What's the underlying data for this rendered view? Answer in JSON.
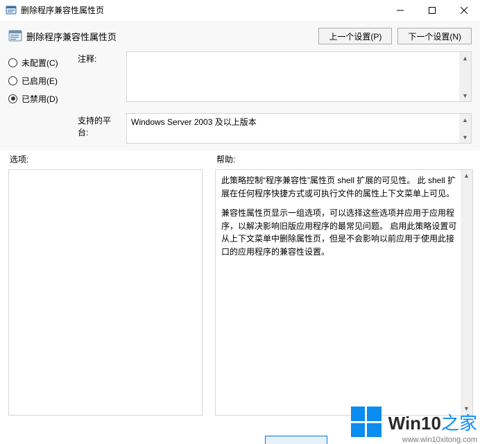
{
  "window": {
    "title": "删除程序兼容性属性页"
  },
  "header": {
    "subtitle": "删除程序兼容性属性页",
    "prev_button": "上一个设置(P)",
    "next_button": "下一个设置(N)"
  },
  "radios": {
    "not_configured": "未配置(C)",
    "enabled": "已启用(E)",
    "disabled": "已禁用(D)",
    "selected": "disabled"
  },
  "fields": {
    "comment_label": "注释:",
    "comment_value": "",
    "platform_label": "支持的平台:",
    "platform_value": "Windows Server 2003 及以上版本"
  },
  "lower": {
    "options_label": "选项:",
    "help_label": "帮助:",
    "help_p1": "此策略控制“程序兼容性”属性页 shell 扩展的可见性。 此 shell 扩展在任何程序快捷方式或可执行文件的属性上下文菜单上可见。",
    "help_p2": "兼容性属性页显示一组选项，可以选择这些选项并应用于应用程序，以解决影响旧版应用程序的最常见问题。 启用此策略设置可从上下文菜单中删除属性页，但是不会影响以前应用于使用此接口的应用程序的兼容性设置。"
  },
  "watermark": {
    "brand_main": "Win10",
    "brand_suffix": "之家",
    "url": "www.win10xitong.com"
  }
}
